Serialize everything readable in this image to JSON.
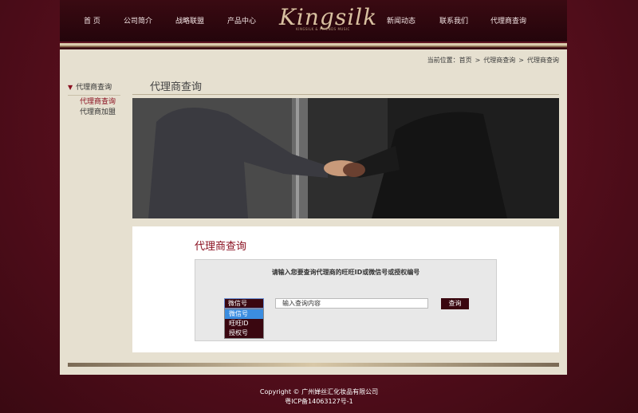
{
  "nav": {
    "items": [
      "首 页",
      "公司简介",
      "战略联盟",
      "产品中心",
      "新闻动态",
      "联系我们",
      "代理商查询"
    ],
    "logo_text": "Kingsilk",
    "logo_sub": "KINGSILK & FRIENDS MUSIC"
  },
  "breadcrumb": {
    "prefix": "当前位置：",
    "items": [
      "首页",
      "代理商查询",
      "代理商查询"
    ],
    "separator": ">"
  },
  "sidebar": {
    "title": "代理商查询",
    "items": [
      {
        "label": "代理商查询",
        "active": true
      },
      {
        "label": "代理商加盟",
        "active": false
      }
    ]
  },
  "main": {
    "title": "代理商查询",
    "query_title": "代理商查询",
    "prompt": "请输入您要查询代理商的旺旺ID或微信号或授权编号",
    "select": {
      "selected": "微信号",
      "options": [
        "微信号",
        "旺旺ID",
        "授权号"
      ],
      "highlighted": "微信号"
    },
    "input_placeholder": "输入查询内容",
    "button": "查询"
  },
  "footer": {
    "line1": "Copyright © 广州婵丝汇化妆品有限公司",
    "line2": "粤ICP备14063127号-1"
  },
  "colors": {
    "brand": "#5a0f1e",
    "accent": "#8a1020",
    "highlight": "#3b8de0"
  }
}
